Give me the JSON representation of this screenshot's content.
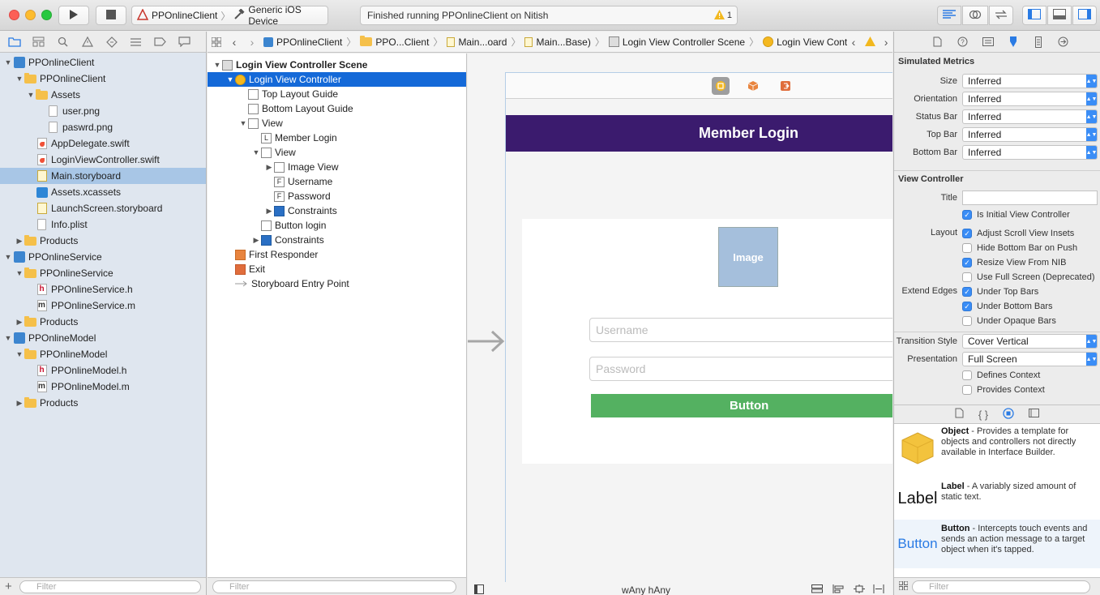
{
  "toolbar": {
    "scheme_name": "PPOnlineClient",
    "device_name": "Generic iOS Device",
    "activity_status": "Finished running PPOnlineClient on Nitish",
    "warning_count": "1"
  },
  "navigator": {
    "filter_placeholder": "Filter",
    "items": [
      {
        "label": "PPOnlineClient",
        "depth": 0,
        "icon": "project-icon",
        "expanded": true
      },
      {
        "label": "PPOnlineClient",
        "depth": 1,
        "icon": "folder-icon",
        "expanded": true
      },
      {
        "label": "Assets",
        "depth": 2,
        "icon": "folder-icon",
        "expanded": true
      },
      {
        "label": "user.png",
        "depth": 3,
        "icon": "image-file-icon"
      },
      {
        "label": "paswrd.png",
        "depth": 3,
        "icon": "image-file-icon"
      },
      {
        "label": "AppDelegate.swift",
        "depth": 2,
        "icon": "swift-file-icon"
      },
      {
        "label": "LoginViewController.swift",
        "depth": 2,
        "icon": "swift-file-icon"
      },
      {
        "label": "Main.storyboard",
        "depth": 2,
        "icon": "storyboard-file-icon",
        "selected": true
      },
      {
        "label": "Assets.xcassets",
        "depth": 2,
        "icon": "asset-catalog-icon"
      },
      {
        "label": "LaunchScreen.storyboard",
        "depth": 2,
        "icon": "storyboard-file-icon"
      },
      {
        "label": "Info.plist",
        "depth": 2,
        "icon": "plist-file-icon"
      },
      {
        "label": "Products",
        "depth": 1,
        "icon": "folder-icon",
        "expanded": false
      },
      {
        "label": "PPOnlineService",
        "depth": 0,
        "icon": "project-icon",
        "expanded": true
      },
      {
        "label": "PPOnlineService",
        "depth": 1,
        "icon": "folder-icon",
        "expanded": true
      },
      {
        "label": "PPOnlineService.h",
        "depth": 2,
        "icon": "header-file-icon"
      },
      {
        "label": "PPOnlineService.m",
        "depth": 2,
        "icon": "objc-file-icon"
      },
      {
        "label": "Products",
        "depth": 1,
        "icon": "folder-icon",
        "expanded": false
      },
      {
        "label": "PPOnlineModel",
        "depth": 0,
        "icon": "project-icon",
        "expanded": true
      },
      {
        "label": "PPOnlineModel",
        "depth": 1,
        "icon": "folder-icon",
        "expanded": true
      },
      {
        "label": "PPOnlineModel.h",
        "depth": 2,
        "icon": "header-file-icon"
      },
      {
        "label": "PPOnlineModel.m",
        "depth": 2,
        "icon": "objc-file-icon"
      },
      {
        "label": "Products",
        "depth": 1,
        "icon": "folder-icon",
        "expanded": false
      }
    ]
  },
  "jumpbar": {
    "crumbs": [
      "PPOnlineClient",
      "PPO...Client",
      "Main...oard",
      "Main...Base)",
      "Login View Controller Scene",
      "Login View Controller"
    ]
  },
  "outline": {
    "filter_placeholder": "Filter",
    "items": [
      {
        "label": "Login View Controller Scene",
        "depth": 0,
        "icon": "scene-icon",
        "bold": true,
        "expanded": true
      },
      {
        "label": "Login View Controller",
        "depth": 1,
        "icon": "view-controller-icon",
        "selected": true,
        "expanded": true
      },
      {
        "label": "Top Layout Guide",
        "depth": 2,
        "icon": "layout-guide-icon"
      },
      {
        "label": "Bottom Layout Guide",
        "depth": 2,
        "icon": "layout-guide-icon"
      },
      {
        "label": "View",
        "depth": 2,
        "icon": "view-icon",
        "expanded": true
      },
      {
        "label": "Member Login",
        "depth": 3,
        "icon": "label-icon",
        "glyph": "L"
      },
      {
        "label": "View",
        "depth": 3,
        "icon": "view-icon",
        "expanded": true
      },
      {
        "label": "Image View",
        "depth": 4,
        "icon": "image-view-icon",
        "collapsed": true
      },
      {
        "label": "Username",
        "depth": 4,
        "icon": "text-field-icon",
        "glyph": "F"
      },
      {
        "label": "Password",
        "depth": 4,
        "icon": "text-field-icon",
        "glyph": "F"
      },
      {
        "label": "Constraints",
        "depth": 4,
        "icon": "constraints-icon",
        "collapsed": true
      },
      {
        "label": "Button login",
        "depth": 3,
        "icon": "button-icon"
      },
      {
        "label": "Constraints",
        "depth": 3,
        "icon": "constraints-icon",
        "collapsed": true
      },
      {
        "label": "First Responder",
        "depth": 1,
        "icon": "first-responder-icon"
      },
      {
        "label": "Exit",
        "depth": 1,
        "icon": "exit-icon"
      },
      {
        "label": "Storyboard Entry Point",
        "depth": 1,
        "icon": "entry-point-arrow-icon"
      }
    ]
  },
  "canvas": {
    "nav_title": "Member Login",
    "image_placeholder": "Image",
    "username_placeholder": "Username",
    "password_placeholder": "Password",
    "button_label": "Button",
    "size_class": "wAny hAny"
  },
  "inspector": {
    "simulated_metrics": {
      "title": "Simulated Metrics",
      "rows": [
        {
          "label": "Size",
          "value": "Inferred"
        },
        {
          "label": "Orientation",
          "value": "Inferred"
        },
        {
          "label": "Status Bar",
          "value": "Inferred"
        },
        {
          "label": "Top Bar",
          "value": "Inferred"
        },
        {
          "label": "Bottom Bar",
          "value": "Inferred"
        }
      ]
    },
    "view_controller": {
      "title": "View Controller",
      "title_label": "Title",
      "title_value": "",
      "initial_vc": {
        "label": "Is Initial View Controller",
        "checked": true
      },
      "layout_label": "Layout",
      "layout_options": [
        {
          "label": "Adjust Scroll View Insets",
          "checked": true
        },
        {
          "label": "Hide Bottom Bar on Push",
          "checked": false
        },
        {
          "label": "Resize View From NIB",
          "checked": true
        },
        {
          "label": "Use Full Screen (Deprecated)",
          "checked": false
        }
      ],
      "extend_edges_label": "Extend Edges",
      "extend_edges": [
        {
          "label": "Under Top Bars",
          "checked": true
        },
        {
          "label": "Under Bottom Bars",
          "checked": true
        },
        {
          "label": "Under Opaque Bars",
          "checked": false
        }
      ],
      "transition_label": "Transition Style",
      "transition_value": "Cover Vertical",
      "presentation_label": "Presentation",
      "presentation_value": "Full Screen",
      "context_options": [
        {
          "label": "Defines Context",
          "checked": false
        },
        {
          "label": "Provides Context",
          "checked": false
        }
      ]
    },
    "library": {
      "filter_placeholder": "Filter",
      "items": [
        {
          "name": "Object",
          "desc": " - Provides a template for objects and controllers not directly available in Interface Builder.",
          "preview": ""
        },
        {
          "name": "Label",
          "desc": " - A variably sized amount of static text.",
          "preview": "Label"
        },
        {
          "name": "Button",
          "desc": " - Intercepts touch events and sends an action message to a target object when it's tapped.",
          "preview": "Button"
        }
      ]
    }
  },
  "colors": {
    "nav_bar": "#3b1b6e",
    "login_button": "#54b161",
    "selection": "#1469d8",
    "image_placeholder": "#a5bfdc"
  }
}
